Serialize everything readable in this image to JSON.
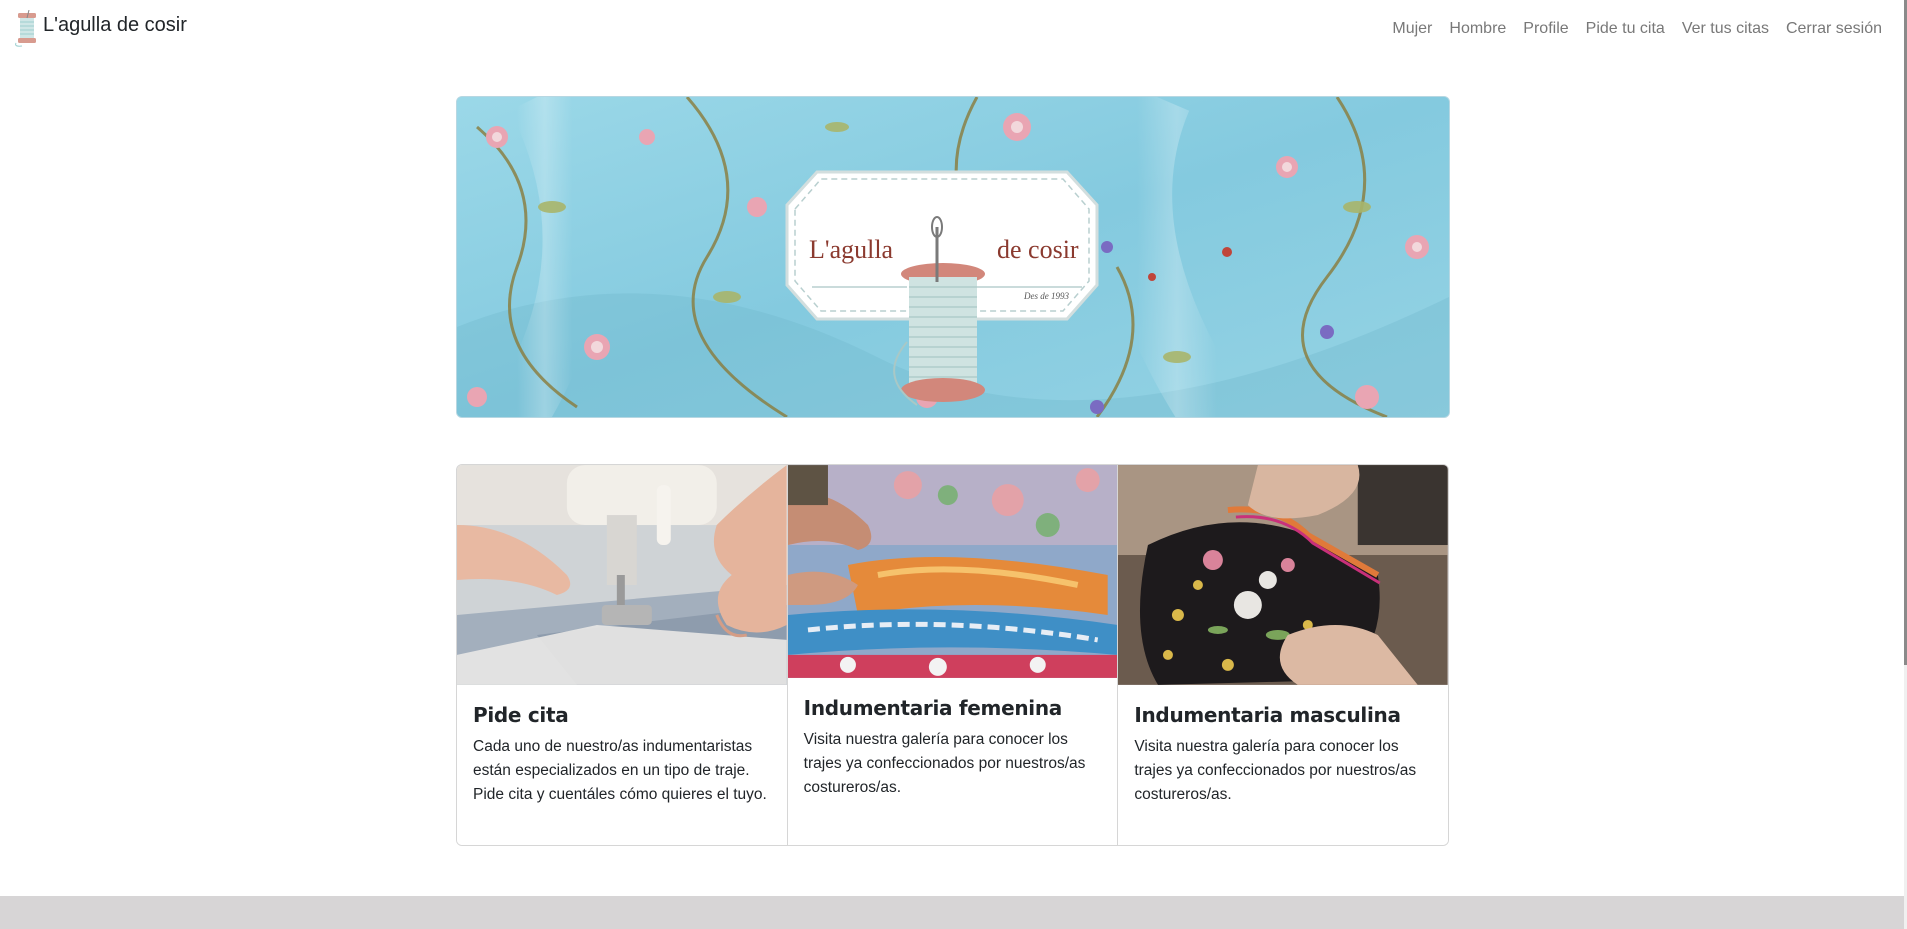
{
  "brand": {
    "name": "L'agulla de cosir",
    "logo_icon": "thread-spool-icon"
  },
  "nav": {
    "items": [
      {
        "label": "Mujer"
      },
      {
        "label": "Hombre"
      },
      {
        "label": "Profile"
      },
      {
        "label": "Pide tu cita"
      },
      {
        "label": "Ver tus citas"
      },
      {
        "label": "Cerrar sesión"
      }
    ]
  },
  "hero": {
    "logo_left": "L'agulla",
    "logo_right": "de cosir",
    "tagline": "Des de 1993"
  },
  "cards": [
    {
      "title": "Pide cita",
      "text": "Cada uno de nuestro/as indumentaristas están especializados en un tipo de traje. Pide cita y cuentáles cómo quieres el tuyo.",
      "image": "sewing-machine-photo"
    },
    {
      "title": "Indumentaria femenina",
      "text": "Visita nuestra galería para conocer los trajes ya confeccionados por nuestros/as costureros/as.",
      "image": "embroidered-fabric-photo"
    },
    {
      "title": "Indumentaria masculina",
      "text": "Visita nuestra galería para conocer los trajes ya confeccionados por nuestros/as costureros/as.",
      "image": "embroidered-garment-photo"
    }
  ],
  "colors": {
    "nav_link": "#787878",
    "hero_fabric": "#8fd1e3",
    "logo_text": "#8b3a2f",
    "footer": "#d7d5d6"
  }
}
